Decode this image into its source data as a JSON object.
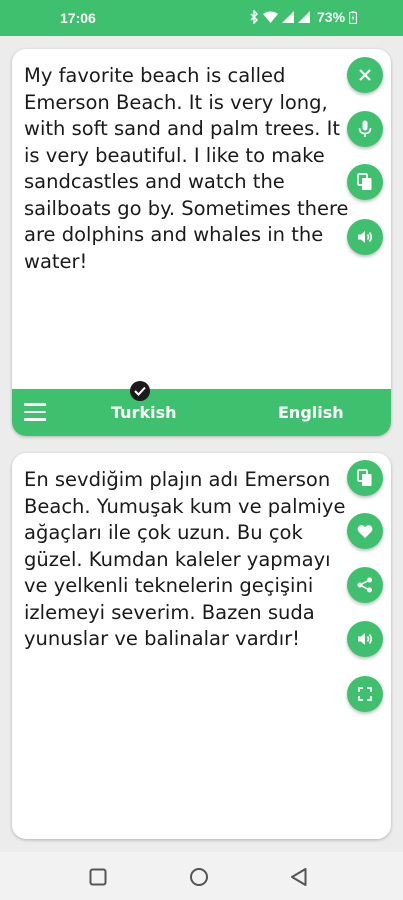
{
  "status": {
    "time": "17:06",
    "battery": "73%"
  },
  "source": {
    "text": "My favorite beach is called Emerson Beach. It is very long, with soft sand and palm trees. It is very beautiful. I like to make sandcastles and watch the sailboats go by. Sometimes there are dolphins and whales in the water!"
  },
  "languages": {
    "source": "Turkish",
    "target": "English"
  },
  "translation": {
    "text": "En sevdiğim plajın adı Emerson Beach. Yumuşak kum ve palmiye ağaçları ile çok uzun. Bu çok güzel. Kumdan kaleler yapmayı ve yelkenli teknelerin geçişini izlemeyi severim. Bazen suda yunuslar ve balinalar vardır!"
  },
  "colors": {
    "accent": "#3fc06e",
    "background": "#ececec",
    "card": "#ffffff"
  },
  "icons": {
    "source_actions": [
      "close-icon",
      "mic-icon",
      "copy-icon",
      "speaker-icon"
    ],
    "target_actions": [
      "copy-icon",
      "heart-icon",
      "share-icon",
      "speaker-icon",
      "fullscreen-icon"
    ],
    "nav": [
      "recents-square-icon",
      "home-circle-icon",
      "back-triangle-icon"
    ]
  }
}
